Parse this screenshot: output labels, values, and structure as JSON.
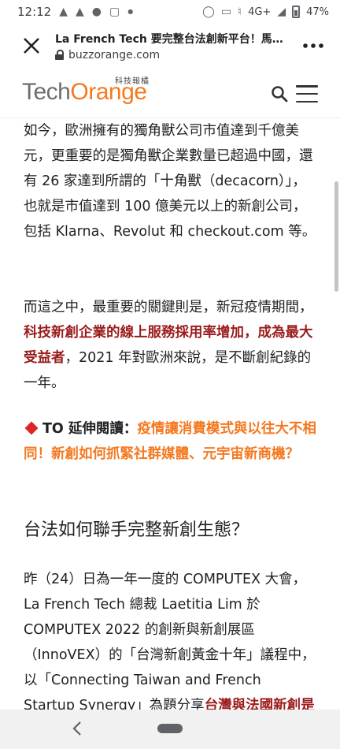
{
  "status_bar": {
    "time": "12:12",
    "network": "4G+",
    "battery": "47%",
    "icons": [
      "android-icon",
      "android-icon",
      "chat-icon",
      "screenshot-icon",
      "dot-icon",
      "alarm-icon",
      "cast-icon",
      "mute-icon",
      "signal-icon",
      "battery-icon"
    ]
  },
  "url_bar": {
    "page_title": "La French Tech 要完整台法創新平台！馬...",
    "domain": "buzzorange.com"
  },
  "header": {
    "logo_part1": "Tech",
    "logo_part2": "Orange",
    "logo_subtitle": "科技報橘"
  },
  "article": {
    "para1": "如今，歐洲擁有的獨角獸公司市值達到千億美元，更重要的是獨角獸企業數量已超過中國，還有 26 家達到所謂的「十角獸（decacorn）」，也就是市值達到 100 億美元以上的新創公司，包括 Klarna、Revolut 和 checkout.com 等。",
    "para2_before": "而這之中，最重要的關鍵則是，新冠疫情期間，",
    "para2_highlight": "科技新創企業的線上服務採用率增加，成為最大受益者",
    "para2_after": "，2021 年對歐洲來說，是不斷創紀錄的一年。",
    "read_more_prefix": "TO 延伸閱讀：",
    "read_more_link": "疫情讓消費模式與以往大不相同！新創如何抓緊社群媒體、元宇宙新商機？",
    "heading": "台法如何聯手完整新創生態？",
    "para4_before": "昨（24）日為一年一度的 COMPUTEX 大會，La French Tech 總裁 Laetitia Lim 於 COMPUTEX 2022 的創新與新創展區（InnoVEX）的「台灣新創黃金十年」議程中，以「Connecting Taiwan and French Startup Synergy」為題分享",
    "para4_highlight": "台灣與法國新創是"
  },
  "colors": {
    "brand_orange": "#f47920",
    "brand_gray": "#6d6e70",
    "highlight_red": "#9b1c1c",
    "diamond_red": "#e02424"
  }
}
